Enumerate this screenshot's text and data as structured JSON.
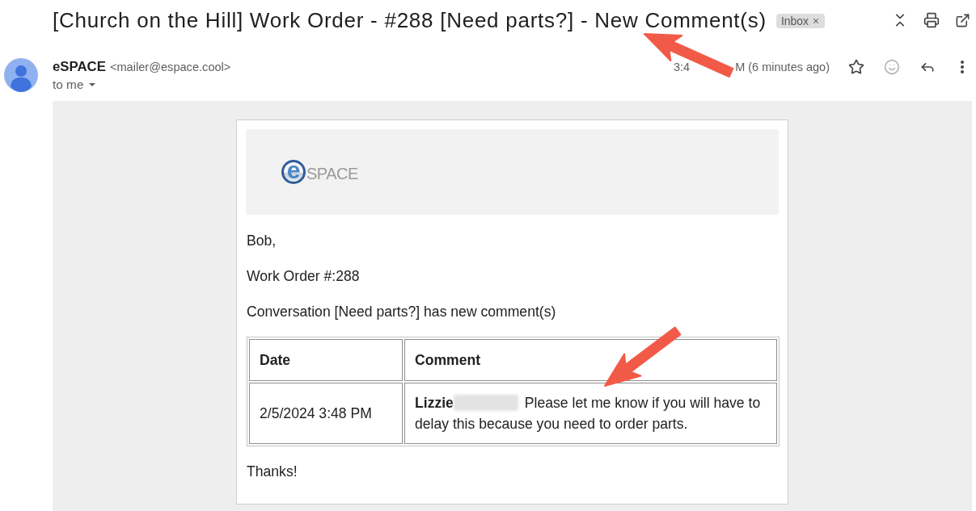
{
  "email": {
    "subject": "[Church on the Hill] Work Order - #288 [Need parts?] - New Comment(s)",
    "labels": [
      {
        "name": "Inbox"
      }
    ]
  },
  "message": {
    "sender_name": "eSPACE",
    "sender_address": "<mailer@espace.cool>",
    "recipient": "to me",
    "time_fragments": [
      "3:4",
      "M (6 minutes ago)"
    ],
    "starred": false
  },
  "body": {
    "logo": {
      "mark": "e",
      "wordmark": "SPACE"
    },
    "greeting": "Bob,",
    "paragraphs": [
      "Work Order #:288",
      "Conversation [Need parts?] has new comment(s)"
    ],
    "table": {
      "columns": [
        "Date",
        "Comment"
      ],
      "rows": [
        {
          "date": "2/5/2024 3:48 PM",
          "author": "Lizzie",
          "author_redacted": true,
          "comment": "Please let me know if you will have to delay this because you need to order parts."
        }
      ]
    },
    "closing": "Thanks!"
  }
}
